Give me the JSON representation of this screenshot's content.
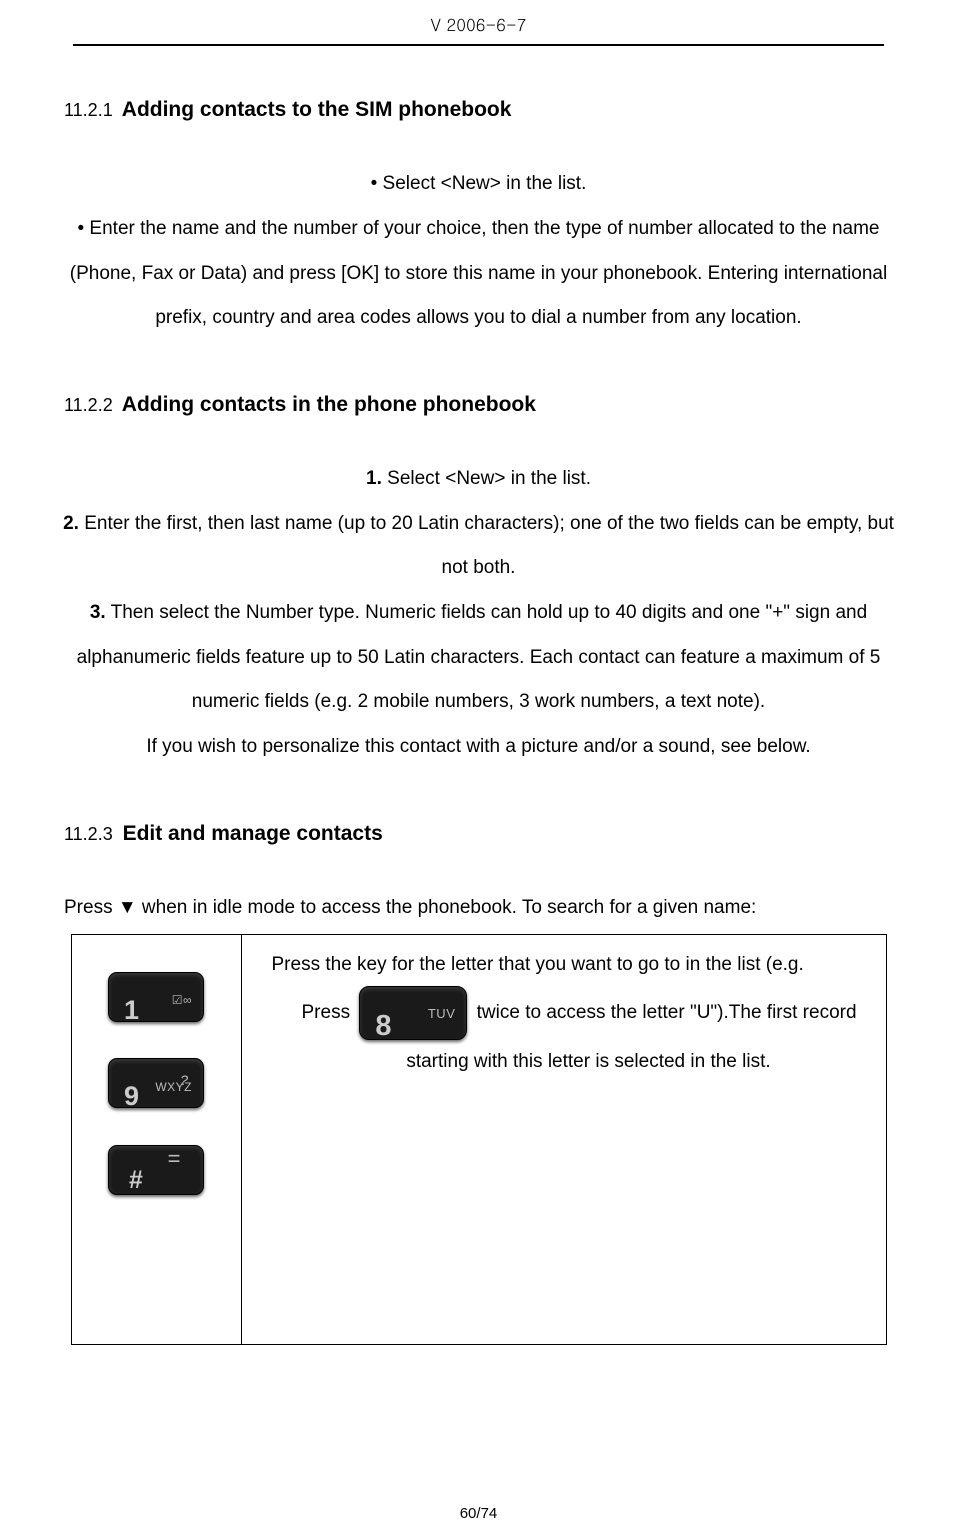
{
  "header": {
    "version": "V 2006-6-7"
  },
  "sec1": {
    "number": "11.2.1",
    "title": "Adding contacts to the SIM phonebook",
    "bullet1": "• Select <New> in the list.",
    "para1": "• Enter the name and the number of your choice, then the type of number allocated to the name (Phone, Fax or Data) and press [OK] to store this name in your phonebook. Entering international prefix, country and area codes allows you to dial a number from any location."
  },
  "sec2": {
    "number": "11.2.2",
    "title": "Adding contacts in the phone phonebook",
    "item1_num": "1.",
    "item1_text": " Select <New> in the list.",
    "item2_num": "2.",
    "item2_text": " Enter the first, then last name (up to 20 Latin characters); one of the two fields can be empty, but not both.",
    "item3_num": "3.",
    "item3_text": " Then select the Number type. Numeric fields can hold up to 40 digits and one \"+\" sign and alphanumeric fields feature up to 50 Latin characters. Each contact can feature a maximum of 5 numeric fields (e.g. 2 mobile numbers, 3 work numbers, a text note).",
    "closing": "If you wish to personalize this contact with a picture and/or a sound, see below."
  },
  "sec3": {
    "number": "11.2.3",
    "title": "Edit and manage contacts",
    "intro": "Press ▼ when in idle mode to access the phonebook. To search for a given name:",
    "table": {
      "keys": [
        {
          "digit": "1",
          "sub": "☑∞",
          "subtop": ""
        },
        {
          "digit": "9",
          "sub": "WXYZ",
          "subtop": "?"
        },
        {
          "digit": "#",
          "sub": "",
          "subtop": "="
        }
      ],
      "desc_line1": "Press the key for the letter that you want to go to in the list (e.g.",
      "desc_press": "Press ",
      "inline_key": {
        "digit": "8",
        "sub": "TUV"
      },
      "desc_after": "twice to access the letter \"U\").The first record",
      "desc_line3": "starting with this letter is selected in the list."
    }
  },
  "footer": {
    "page": "60/74"
  }
}
